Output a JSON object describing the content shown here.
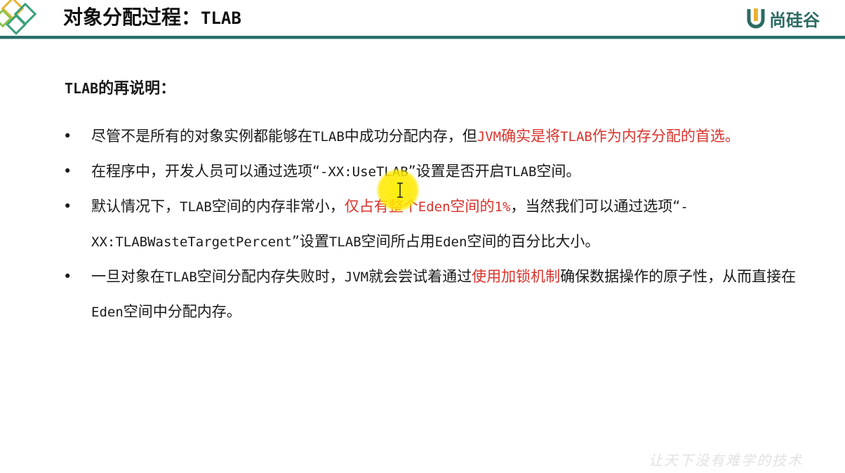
{
  "header": {
    "title_cn": "对象分配过程：",
    "title_code": "TLAB",
    "logo_text": "尚硅谷",
    "accent_color": "#2a6e68",
    "logo_icon": "u-logo-icon",
    "ornament_icon": "diamond-ornament-icon"
  },
  "subtitle": {
    "code": "TLAB",
    "text": "的再说明："
  },
  "bullets": [
    {
      "p1": "尽管不是所有的对象实例都能够在",
      "p2": "TLAB",
      "p3": "中成功分配内存，但",
      "p4": "JVM",
      "p5": "确实是将",
      "p6": "TLAB",
      "p7": "作为内存分配的首选。"
    },
    {
      "p1": "在程序中，开发人员可以通过选项“",
      "p2": "-XX:UseTLAB",
      "p3": "”设置是否开启",
      "p4": "TLAB",
      "p5": "空间。"
    },
    {
      "p1": "默认情况下，",
      "p2": "TLAB",
      "p3": "空间的内存非常小，",
      "p4": "仅占有整个",
      "p5": "Eden",
      "p6": "空间的",
      "p7": "1%",
      "p8": "，当然我们可以通过选项“",
      "p9": "-XX:TLABWasteTargetPercent",
      "p10": "”设置",
      "p11": "TLAB",
      "p12": "空间所占用",
      "p13": "Eden",
      "p14": "空间的百分比大小。"
    },
    {
      "p1": "一旦对象在",
      "p2": "TLAB",
      "p3": "空间分配内存失败时，",
      "p4": "JVM",
      "p5": "就会尝试着通过",
      "p6": "使用加锁机制",
      "p7": "确保数据操作的原子性，从而直接在",
      "p8": "Eden",
      "p9": "空间中分配内存。"
    }
  ],
  "bullet_symbol": "•",
  "highlight_color": "#d9332c",
  "watermark": "让天下没有难学的技术",
  "cursor_icon": "text-cursor-icon"
}
